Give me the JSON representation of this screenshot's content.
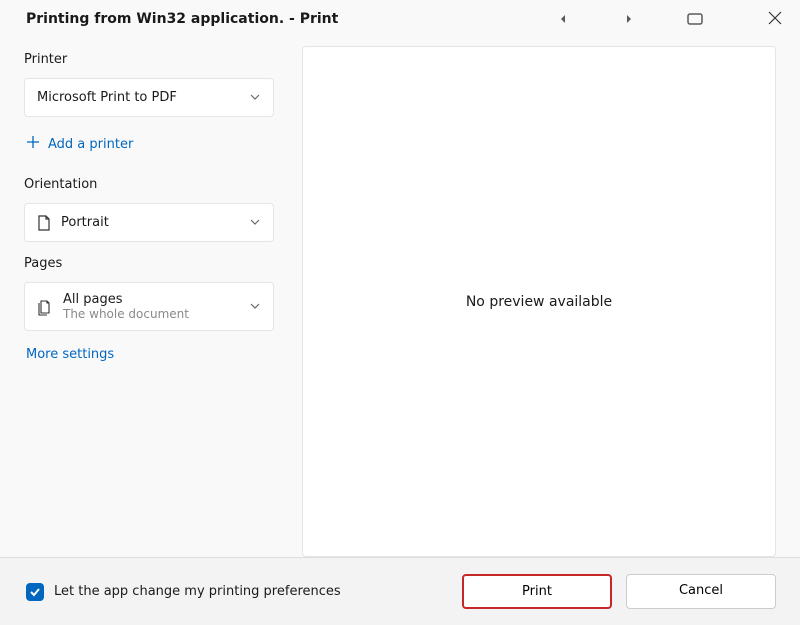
{
  "dialog": {
    "title": "Printing from Win32 application. - Print"
  },
  "printer": {
    "label": "Printer",
    "selected": "Microsoft Print to PDF",
    "add_link": "Add a printer"
  },
  "orientation": {
    "label": "Orientation",
    "selected": "Portrait"
  },
  "pages": {
    "label": "Pages",
    "selected": "All pages",
    "sub": "The whole document"
  },
  "more_settings": "More settings",
  "preview": {
    "message": "No preview available"
  },
  "footer": {
    "checkbox_label": "Let the app change my printing preferences",
    "print_label": "Print",
    "cancel_label": "Cancel"
  }
}
